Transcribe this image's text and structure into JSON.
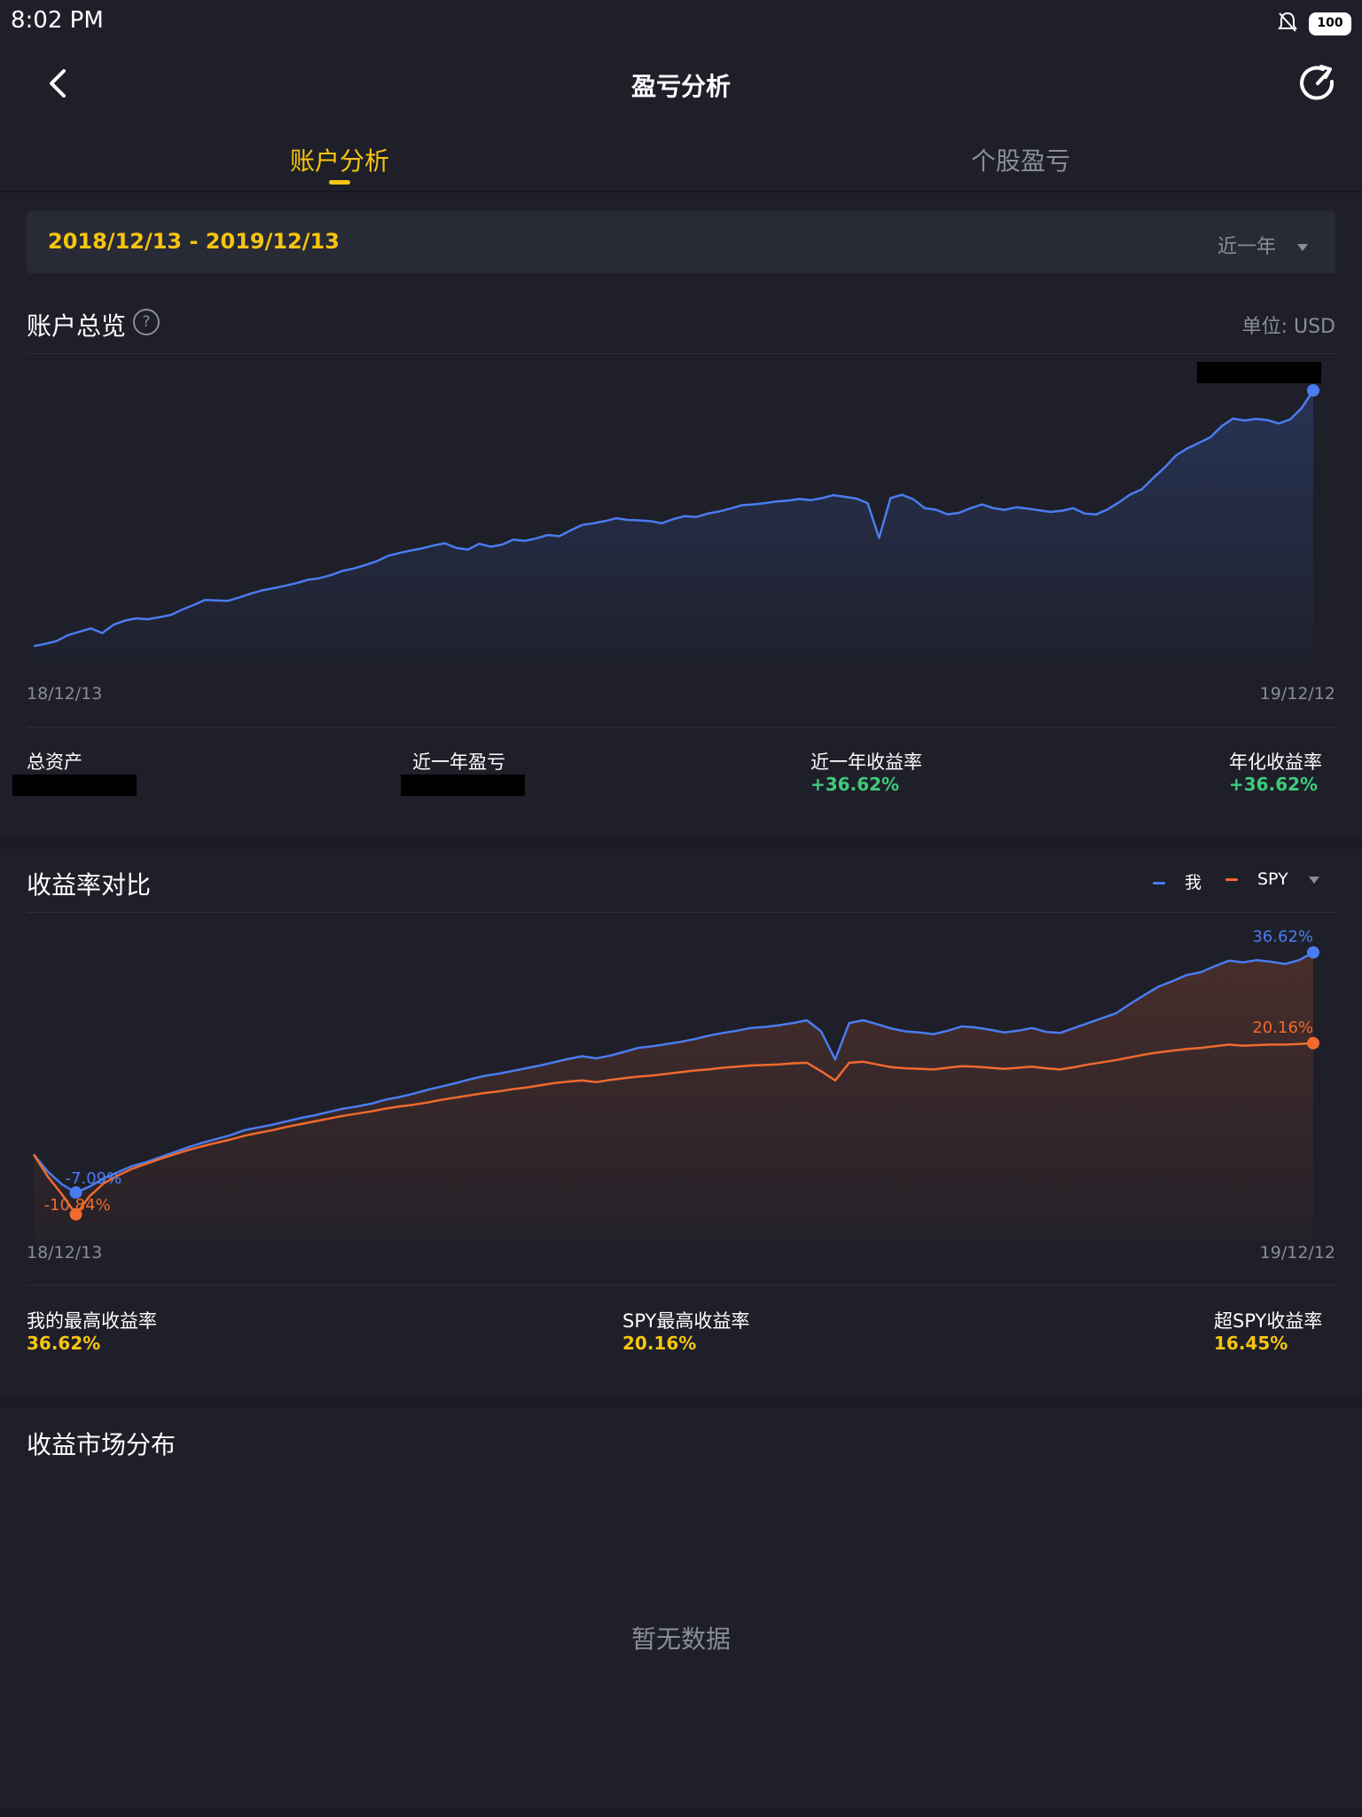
{
  "status_bar": {
    "time": "8:02  PM",
    "battery": "100"
  },
  "header": {
    "title": "盈亏分析"
  },
  "tabs": [
    {
      "label": "账户分析",
      "active": true
    },
    {
      "label": "个股盈亏",
      "active": false
    }
  ],
  "date_filter": {
    "range": "2018/12/13 - 2019/12/13",
    "preset": "近一年"
  },
  "overview": {
    "title": "账户总览",
    "unit": "单位: USD",
    "stats": [
      {
        "label": "总资产",
        "value": ""
      },
      {
        "label": "近一年盈亏",
        "value": ""
      },
      {
        "label": "近一年收益率",
        "value": "+36.62%"
      },
      {
        "label": "年化收益率",
        "value": "+36.62%"
      }
    ]
  },
  "comparison": {
    "title": "收益率对比",
    "legend_me": "我",
    "legend_spy": "SPY",
    "stats": [
      {
        "label": "我的最高收益率",
        "value": "36.62%"
      },
      {
        "label": "SPY最高收益率",
        "value": "20.16%"
      },
      {
        "label": "超SPY收益率",
        "value": "16.45%"
      }
    ]
  },
  "distribution": {
    "title": "收益市场分布",
    "empty_text": "暂无数据"
  },
  "colors": {
    "accent": "#f6c50f",
    "positive": "#3ecb7c",
    "me_line": "#4a7cf0",
    "spy_line": "#f06a2e",
    "background": "#1e1f29"
  },
  "chart_data": [
    {
      "type": "line",
      "title": "账户总览",
      "x_start": "18/12/13",
      "x_end": "19/12/12",
      "series": [
        {
          "values": [
            0.0,
            0.5,
            1.2,
            2.6,
            3.4,
            4.2,
            3.1,
            5.1,
            6.1,
            6.6,
            6.4,
            6.9,
            7.4,
            8.7,
            9.8,
            11.0,
            10.9,
            10.8,
            11.6,
            12.5,
            13.3,
            13.8,
            14.4,
            15.0,
            15.8,
            16.2,
            16.9,
            17.9,
            18.5,
            19.3,
            20.2,
            21.5,
            22.2,
            22.8,
            23.3,
            24.0,
            24.5,
            23.4,
            23.0,
            24.4,
            23.7,
            24.2,
            25.4,
            25.1,
            25.7,
            26.5,
            26.2,
            27.6,
            28.9,
            29.3,
            29.8,
            30.5,
            30.1,
            30.0,
            29.8,
            29.3,
            30.3,
            31.0,
            30.8,
            31.6,
            32.1,
            32.8,
            33.6,
            33.8,
            34.1,
            34.5,
            34.7,
            35.1,
            34.8,
            35.3,
            36.0,
            35.6,
            35.2,
            34.1,
            25.8,
            35.3,
            36.1,
            35.0,
            32.9,
            32.5,
            31.4,
            31.8,
            32.9,
            33.8,
            32.9,
            32.5,
            33.1,
            32.8,
            32.4,
            32.0,
            32.3,
            32.9,
            31.6,
            31.4,
            32.6,
            34.3,
            36.2,
            37.4,
            40.1,
            42.6,
            45.5,
            47.2,
            48.5,
            49.8,
            52.5,
            54.3,
            53.8,
            54.2,
            53.9,
            53.1,
            54.1,
            56.8,
            61.0
          ]
        }
      ],
      "end_marker": true
    },
    {
      "type": "line",
      "title": "收益率对比",
      "x_start": "18/12/13",
      "x_end": "19/12/12",
      "series": [
        {
          "name": "我",
          "values": [
            0.0,
            -3.1,
            -5.4,
            -6.9,
            -5.8,
            -4.3,
            -3.2,
            -2.1,
            -1.4,
            -0.5,
            0.4,
            1.3,
            2.1,
            2.8,
            3.5,
            4.4,
            4.9,
            5.4,
            6.0,
            6.6,
            7.1,
            7.7,
            8.3,
            8.7,
            9.2,
            9.9,
            10.4,
            11.0,
            11.7,
            12.3,
            12.9,
            13.6,
            14.2,
            14.6,
            15.1,
            15.6,
            16.1,
            16.7,
            17.3,
            17.8,
            17.4,
            17.9,
            18.6,
            19.3,
            19.6,
            20.0,
            20.4,
            20.9,
            21.5,
            22.0,
            22.4,
            22.9,
            23.1,
            23.4,
            23.8,
            24.3,
            22.3,
            17.2,
            23.8,
            24.3,
            23.6,
            22.8,
            22.3,
            22.1,
            21.8,
            22.4,
            23.2,
            23.0,
            22.6,
            22.1,
            22.4,
            22.9,
            22.2,
            22.0,
            22.9,
            23.8,
            24.7,
            25.6,
            27.3,
            28.9,
            30.4,
            31.4,
            32.5,
            33.0,
            34.1,
            35.1,
            34.8,
            35.2,
            34.9,
            34.5,
            35.2,
            36.6
          ]
        },
        {
          "name": "SPY",
          "values": [
            0.0,
            -4.0,
            -7.2,
            -10.84,
            -7.5,
            -5.2,
            -3.8,
            -2.6,
            -1.7,
            -0.8,
            0.0,
            0.8,
            1.5,
            2.1,
            2.7,
            3.4,
            3.9,
            4.4,
            5.0,
            5.5,
            6.0,
            6.5,
            7.0,
            7.4,
            7.8,
            8.3,
            8.7,
            9.0,
            9.4,
            9.9,
            10.3,
            10.7,
            11.1,
            11.4,
            11.8,
            12.1,
            12.5,
            12.9,
            13.2,
            13.4,
            13.1,
            13.5,
            13.8,
            14.1,
            14.3,
            14.6,
            14.9,
            15.2,
            15.4,
            15.7,
            15.9,
            16.1,
            16.2,
            16.3,
            16.5,
            16.6,
            15.1,
            13.4,
            16.6,
            16.8,
            16.3,
            15.8,
            15.6,
            15.5,
            15.4,
            15.7,
            16.0,
            15.9,
            15.7,
            15.5,
            15.7,
            15.9,
            15.6,
            15.4,
            15.8,
            16.3,
            16.7,
            17.1,
            17.6,
            18.1,
            18.5,
            18.8,
            19.1,
            19.3,
            19.6,
            19.9,
            19.7,
            19.8,
            19.9,
            19.9,
            20.0,
            20.16
          ]
        }
      ],
      "annotations": [
        "36.62%",
        "20.16%",
        "-7.09%",
        "-10.84%"
      ]
    }
  ]
}
